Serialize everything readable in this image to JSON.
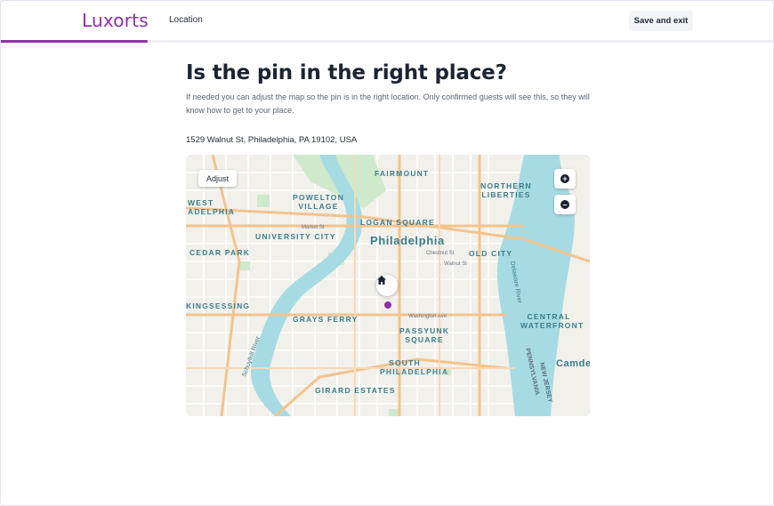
{
  "colors": {
    "brand": "#8e2fa8",
    "text": "#1c2433",
    "map_water": "#a7dbe3",
    "map_park": "#cfe9cd",
    "map_major_road": "#f4c38d"
  },
  "header": {
    "logo": "Luxorts",
    "nav_location": "Location",
    "save_exit": "Save and exit",
    "progress": 0.19
  },
  "main": {
    "title": "Is the pin in the right place?",
    "subtitle": "If needed you can adjust the map so the pin is in the right location. Only confirmed guests will see this, so they will know how to get to your place.",
    "address": "1529 Walnut St, Philadelphia, PA 19102, USA"
  },
  "map": {
    "adjust_label": "Adjust",
    "zoom_in_icon": "plus-icon",
    "zoom_out_icon": "minus-icon",
    "marker_icon": "home-icon",
    "labels": {
      "philadelphia": "Philadelphia",
      "fairmount": "FAIRMOUNT",
      "northern_liberties": "NORTHERN LIBERTIES",
      "powelton_village": "POWELTON VILLAGE",
      "west_philadelphia": "WEST ADELPHIA",
      "logan_square": "LOGAN SQUARE",
      "university_city": "UNIVERSITY CITY",
      "old_city": "OLD CITY",
      "cedar_park": "CEDAR PARK",
      "kingsessing": "KINGSESSING",
      "grays_ferry": "GRAYS FERRY",
      "passyunk_square": "PASSYUNK SQUARE",
      "south_philadelphia": "SOUTH PHILADELPHIA",
      "girard_estates": "GIRARD ESTATES",
      "central_waterfront": "CENTRAL WATERFRONT",
      "camden": "Camde",
      "market_st": "Market St",
      "chestnut_st": "Chestnut St",
      "walnut_st": "Walnut St",
      "washington_ave": "Washington Ave",
      "delaware_river": "Delaware River",
      "new_jersey": "NEW JERSEY",
      "pennsylvania": "PENNSYLVANIA",
      "schuylkill_river": "Schuylkill River"
    }
  }
}
